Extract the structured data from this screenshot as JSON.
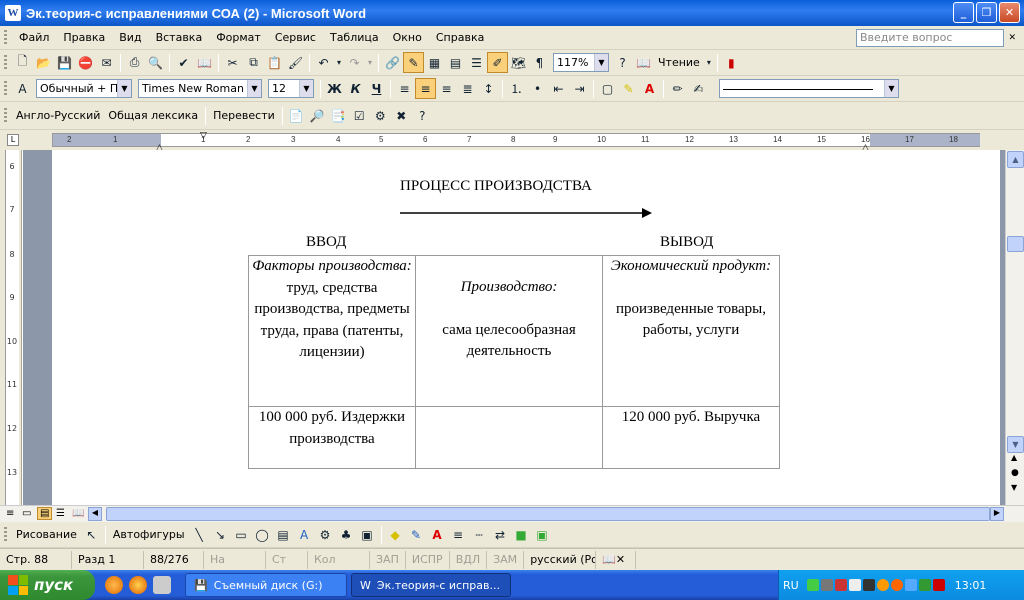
{
  "window": {
    "title": "Эк.теория-с исправлениями СОА (2) - Microsoft Word",
    "app_icon": "W"
  },
  "menu": {
    "items": [
      "Файл",
      "Правка",
      "Вид",
      "Вставка",
      "Формат",
      "Сервис",
      "Таблица",
      "Окно",
      "Справка"
    ],
    "help_placeholder": "Введите вопрос"
  },
  "toolbar_standard": {
    "zoom": "117%",
    "reading_label": "Чтение"
  },
  "toolbar_format": {
    "style": "Обычный + По ц",
    "font": "Times New Roman",
    "size": "12",
    "bold": "Ж",
    "italic": "К",
    "underline": "Ч"
  },
  "toolbar_translate": {
    "lang": "Англо-Русский",
    "vocab": "Общая лексика",
    "translate": "Перевести"
  },
  "ruler": {
    "h_ticks": [
      "2",
      "1",
      "1",
      "2",
      "3",
      "4",
      "5",
      "6",
      "7",
      "8",
      "9",
      "10",
      "11",
      "12",
      "13",
      "14",
      "15",
      "16",
      "17",
      "18"
    ],
    "v_ticks": [
      "6",
      "7",
      "8",
      "9",
      "10",
      "11",
      "12",
      "13"
    ]
  },
  "document": {
    "heading": "ПРОЦЕСС ПРОИЗВОДСТВА",
    "input_label": "ВВОД",
    "output_label": "ВЫВОД",
    "table": {
      "r1c1_italic": "Факторы производства:",
      "r1c1_text": "труд, средства производства, предметы труда, права (патенты, лицензии)",
      "r1c2_italic": "Производство:",
      "r1c2_text": "сама целесообразная деятельность",
      "r1c3_italic": "Экономический продукт:",
      "r1c3_text": "произведенные товары, работы, услуги",
      "r2c1": "100 000 руб. Издержки производства",
      "r2c2": "",
      "r2c3": "120 000 руб. Выручка"
    }
  },
  "drawing": {
    "draw_label": "Рисование",
    "autoshapes_label": "Автофигуры"
  },
  "status": {
    "page": "Стр.  88",
    "section": "Разд  1",
    "pages": "88/276",
    "at": "На",
    "line": "Ст",
    "col": "Кол",
    "rec": "ЗАП",
    "trk": "ИСПР",
    "ext": "ВДЛ",
    "ovr": "ЗАМ",
    "lang": "русский (Ро"
  },
  "taskbar": {
    "start": "пуск",
    "tasks": [
      "Съемный диск (G:)",
      "Эк.теория-с исправ..."
    ],
    "lang": "RU",
    "clock": "13:01"
  },
  "colors": {
    "titlebar": "#0a5fd8",
    "taskbar": "#245dd7",
    "start": "#3c963c",
    "chrome": "#ece9d8"
  }
}
